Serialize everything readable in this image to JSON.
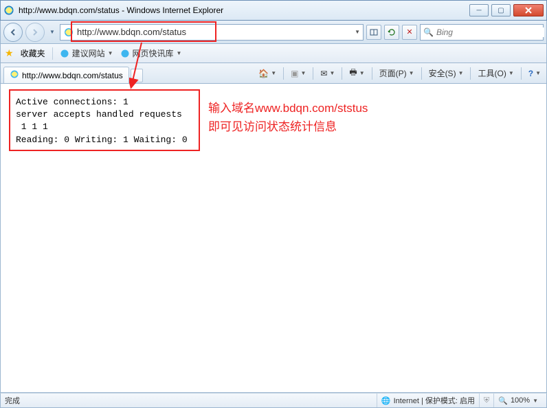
{
  "window": {
    "title": "http://www.bdqn.com/status - Windows Internet Explorer"
  },
  "nav": {
    "url": "http://www.bdqn.com/status",
    "refresh_tip": "刷新",
    "stop_tip": "停止",
    "search_placeholder": "Bing"
  },
  "fav": {
    "label": "收藏夹",
    "suggested": "建议网站",
    "slice": "网页快讯库"
  },
  "tab": {
    "title": "http://www.bdqn.com/status"
  },
  "cmd": {
    "home": "主页",
    "feeds": "源",
    "mail": "邮件",
    "print": "打印",
    "page": "页面(P)",
    "safety": "安全(S)",
    "tools": "工具(O)",
    "help": "帮助"
  },
  "status_text": "Active connections: 1\nserver accepts handled requests\n 1 1 1\nReading: 0 Writing: 1 Waiting: 0",
  "annotation": {
    "line1": "输入域名www.bdqn.com/ststus",
    "line2": "即可见访问状态统计信息"
  },
  "statusbar": {
    "done": "完成",
    "zone": "Internet | 保护模式: 启用",
    "zoom": "100%"
  }
}
